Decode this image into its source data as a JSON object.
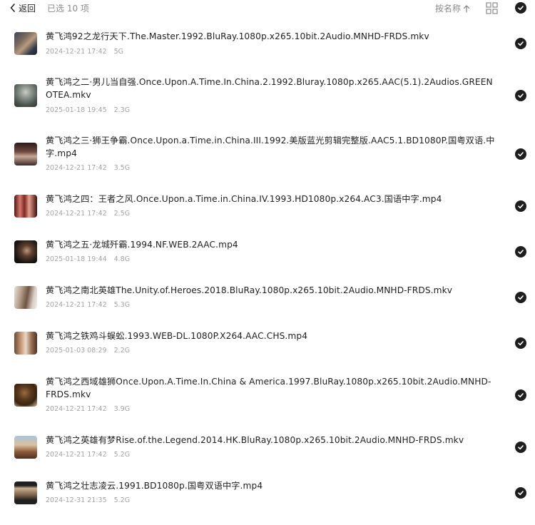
{
  "header": {
    "back_label": "返回",
    "selected_text": "已选 10 项",
    "sort_label": "按名称",
    "sort_icon": "arrow-up-icon",
    "view_icon": "grid-view-icon",
    "select_all_icon": "check-circle-icon"
  },
  "colors": {
    "check_fill": "#1e1e1e",
    "meta_text": "#a3a3a3",
    "secondary_text": "#8a8a8a"
  },
  "files": [
    {
      "title": "黄飞鸿92之龙行天下.The.Master.1992.BluRay.1080p.x265.10bit.2Audio.MNHD-FRDS.mkv",
      "date": "2024-12-21 17:42",
      "size": "5G",
      "selected": true
    },
    {
      "title": "黄飞鸿之二·男儿当自强.Once.Upon.A.Time.In.China.2.1992.Bluray.1080p.x265.AAC(5.1).2Audios.GREENOTEA.mkv",
      "date": "2025-01-18 19:45",
      "size": "2.3G",
      "selected": true
    },
    {
      "title": "黄飞鸿之三·狮王争霸.Once.Upon.a.Time.in.China.III.1992.美版蓝光剪辑完整版.AAC5.1.BD1080P.国粤双语.中字.mp4",
      "date": "2024-12-21 17:42",
      "size": "3.5G",
      "selected": true
    },
    {
      "title": "黄飞鸿之四：王者之风.Once.Upon.a.Time.in.China.IV.1993.HD1080p.x264.AC3.国语中字.mp4",
      "date": "2024-12-21 17:42",
      "size": "2.5G",
      "selected": true
    },
    {
      "title": "黄飞鸿之五·龙城歼霸.1994.NF.WEB.2AAC.mp4",
      "date": "2025-01-18 19:44",
      "size": "4.8G",
      "selected": true
    },
    {
      "title": "黄飞鸿之南北英雄The.Unity.of.Heroes.2018.BluRay.1080p.x265.10bit.2Audio.MNHD-FRDS.mkv",
      "date": "2024-12-21 17:42",
      "size": "5.3G",
      "selected": true
    },
    {
      "title": "黄飞鸿之铁鸡斗蜈蚣.1993.WEB-DL.1080P.X264.AAC.CHS.mp4",
      "date": "2025-01-03 08:29",
      "size": "2.2G",
      "selected": true
    },
    {
      "title": "黄飞鸿之西域雄狮Once.Upon.A.Time.In.China & America.1997.BluRay.1080p.x265.10bit.2Audio.MNHD-FRDS.mkv",
      "date": "2024-12-21 17:42",
      "size": "3.9G",
      "selected": true
    },
    {
      "title": "黄飞鸿之英雄有梦Rise.of.the.Legend.2014.HK.BluRay.1080p.x265.10bit.2Audio.MNHD-FRDS.mkv",
      "date": "2024-12-21 17:42",
      "size": "5.2G",
      "selected": true
    },
    {
      "title": "黄飞鸿之壮志凌云.1991.BD1080p.国粤双语中字.mp4",
      "date": "2024-12-31 21:35",
      "size": "5.2G",
      "selected": true
    }
  ]
}
